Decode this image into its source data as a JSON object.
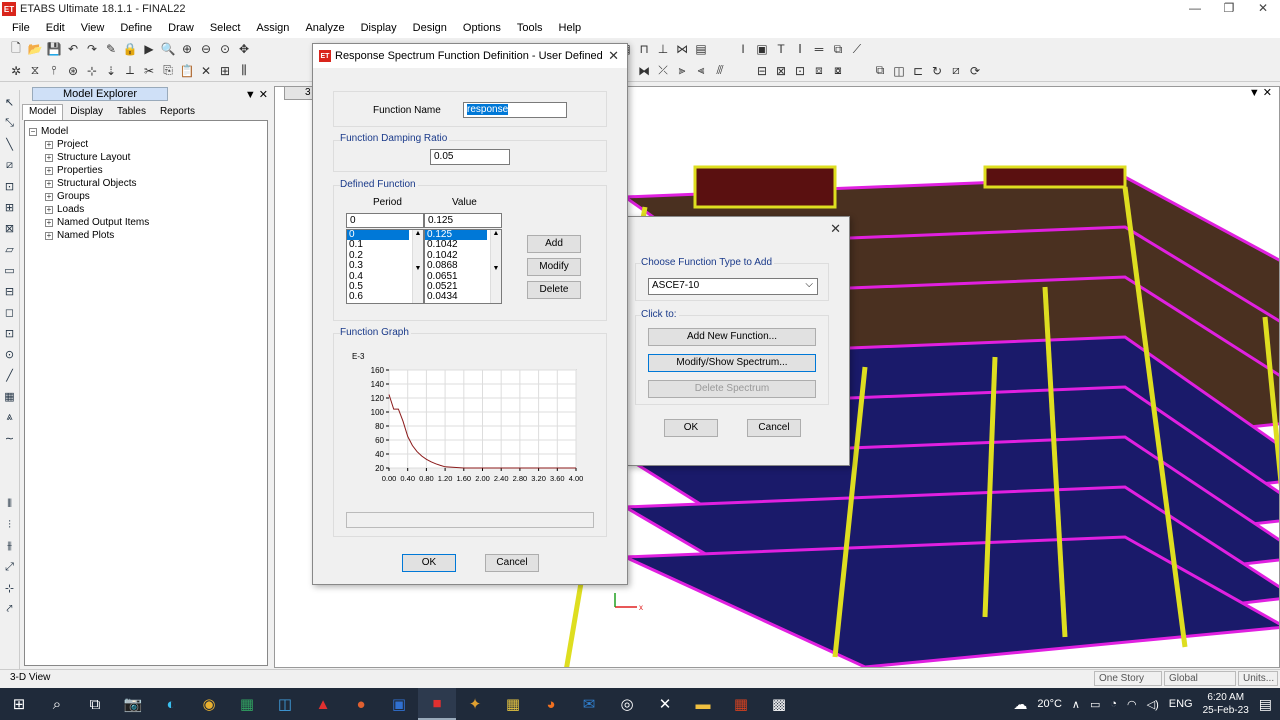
{
  "window": {
    "logo": "ET",
    "title": "ETABS Ultimate 18.1.1 - FINAL22",
    "controls": [
      "—",
      "❐",
      "✕"
    ]
  },
  "menu": [
    "File",
    "Edit",
    "View",
    "Define",
    "Draw",
    "Select",
    "Assign",
    "Analyze",
    "Display",
    "Design",
    "Options",
    "Tools",
    "Help"
  ],
  "explorer": {
    "title": "Model Explorer",
    "controls": "▼ ✕",
    "tabs": [
      "Model",
      "Display",
      "Tables",
      "Reports"
    ],
    "root": "Model",
    "items": [
      "Project",
      "Structure Layout",
      "Properties",
      "Structural Objects",
      "Groups",
      "Loads",
      "Named Output Items",
      "Named Plots"
    ]
  },
  "view": {
    "tab": "3",
    "controls": "▼ ✕"
  },
  "response_dialog": {
    "logo": "ET",
    "title": "Response Spectrum Function Definition - User Defined",
    "close": "✕",
    "function_name_label": "Function Name",
    "function_name_value": "response",
    "damping_group": "Function Damping Ratio",
    "damping_value": "0.05",
    "defined_group": "Defined Function",
    "period_header": "Period",
    "value_header": "Value",
    "period_input": "0",
    "value_input": "0.125",
    "periods": [
      "0",
      "0.1",
      "0.2",
      "0.3",
      "0.4",
      "0.5",
      "0.6"
    ],
    "values": [
      "0.125",
      "0.1042",
      "0.1042",
      "0.0868",
      "0.0651",
      "0.0521",
      "0.0434"
    ],
    "add_button": "Add",
    "modify_button": "Modify",
    "delete_button": "Delete",
    "graph_group": "Function Graph",
    "ok_button": "OK",
    "cancel_button": "Cancel"
  },
  "chart_data": {
    "type": "line",
    "title": "",
    "xlabel": "",
    "ylabel": "E-3",
    "xlim": [
      0,
      4
    ],
    "ylim": [
      20,
      160
    ],
    "x_ticks": [
      "0.00",
      "0.40",
      "0.80",
      "1.20",
      "1.60",
      "2.00",
      "2.40",
      "2.80",
      "3.20",
      "3.60",
      "4.00"
    ],
    "y_ticks": [
      "160",
      "140",
      "120",
      "100",
      "80",
      "60",
      "40",
      "20"
    ],
    "grid": true,
    "color": "#8b1a1a",
    "series": [
      {
        "x": [
          0,
          0.1,
          0.2,
          0.3,
          0.4,
          0.5,
          0.6,
          0.7,
          0.8,
          0.9,
          1.0,
          1.1,
          1.2,
          1.6,
          2.0,
          2.4,
          2.8,
          3.2,
          3.6,
          4.0
        ],
        "y": [
          125,
          104.2,
          104.2,
          86.8,
          65.1,
          52.1,
          43.4,
          37.2,
          32.5,
          28.9,
          26.0,
          23.7,
          21.7,
          20,
          20,
          20,
          20,
          20,
          20,
          20
        ]
      }
    ]
  },
  "choose_dialog": {
    "close": "✕",
    "group_label": "Choose  Function Type to Add",
    "type_value": "ASCE7-10",
    "click_label": "Click to:",
    "add_new": "Add New Function...",
    "modify_show": "Modify/Show Spectrum...",
    "delete_spectrum": "Delete Spectrum",
    "ok_button": "OK",
    "cancel_button": "Cancel"
  },
  "statusbar": {
    "view_label": "3-D View",
    "story": "One Story",
    "coord": "Global",
    "units": "Units..."
  },
  "taskbar": {
    "weather": "20°C",
    "language": "ENG",
    "time": "6:20 AM",
    "date": "25-Feb-23"
  },
  "icons": [
    "search-icon",
    "task-view-icon",
    "camera-icon",
    "edge-icon",
    "chrome-icon",
    "excel-icon",
    "store-icon",
    "acrobat-icon",
    "powerpoint-icon",
    "word-icon",
    "etabs-icon",
    "firefox-icon",
    "outlook-icon"
  ]
}
